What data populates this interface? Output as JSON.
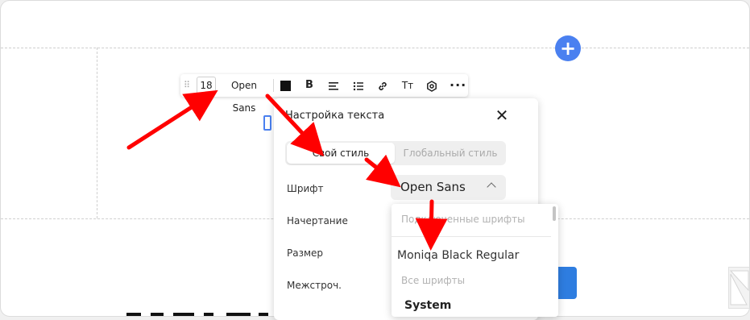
{
  "canvas": {
    "add_block_label": "+"
  },
  "toolbar": {
    "drag_handle": "⠿",
    "font_size": "18",
    "font_name": "Open Sans",
    "text_color": "#111111",
    "bold_label": "B",
    "text_size_label": "Tт",
    "more_label": "···",
    "icons": [
      "drag-handle-icon",
      "color-swatch-icon",
      "bold-icon",
      "align-left-icon",
      "list-icon",
      "link-icon",
      "text-size-icon",
      "gear-icon",
      "more-icon"
    ]
  },
  "panel": {
    "title": "Настройка текста",
    "close_label": "✕",
    "tabs": [
      {
        "label": "Свой стиль",
        "active": true
      },
      {
        "label": "Глобальный стиль",
        "active": false
      }
    ],
    "rows": [
      {
        "label": "Шрифт"
      },
      {
        "label": "Начертание"
      },
      {
        "label": "Размер"
      },
      {
        "label": "Межстроч."
      }
    ],
    "font_select": {
      "value": "Open Sans"
    }
  },
  "dropdown": {
    "connected_header": "Подключенные шрифты",
    "connected_fonts": [
      "Moniqa Black Regular"
    ],
    "all_header": "Все шрифты",
    "all_fonts": [
      "System"
    ]
  },
  "colors": {
    "accent": "#4a80f0",
    "button_blue": "#2e7de0",
    "annotation_arrow": "#ff0000"
  }
}
